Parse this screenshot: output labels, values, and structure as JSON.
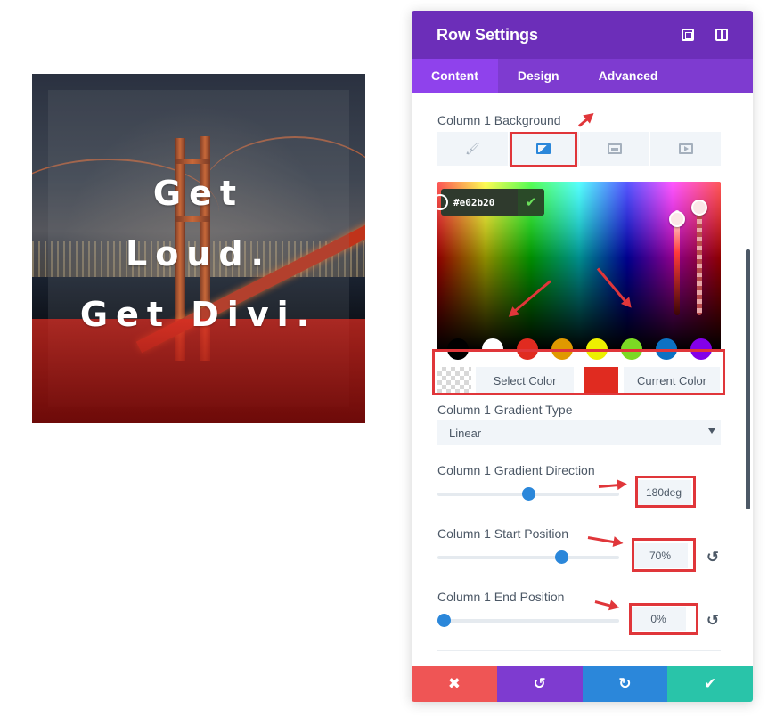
{
  "preview": {
    "headline_lines": [
      "Get",
      "Loud.",
      "Get Divi."
    ]
  },
  "panel": {
    "title": "Row Settings",
    "header_icons": [
      "expand-icon",
      "sidebar-toggle-icon"
    ],
    "tabs": [
      {
        "label": "Content",
        "active": true
      },
      {
        "label": "Design",
        "active": false
      },
      {
        "label": "Advanced",
        "active": false
      }
    ]
  },
  "background": {
    "label": "Column 1 Background",
    "type_tabs": [
      "color-bucket-icon",
      "gradient-icon",
      "image-icon",
      "video-icon"
    ],
    "active_type": "gradient-icon",
    "hex_value": "#e02b20",
    "swatches": [
      "#000000",
      "#ffffff",
      "#e02b20",
      "#e09900",
      "#edf000",
      "#7cda24",
      "#0c71c3",
      "#8300e9"
    ],
    "select_color_label": "Select Color",
    "current_color_label": "Current Color",
    "current_color": "#e02b20"
  },
  "gradient_type": {
    "label": "Column 1 Gradient Type",
    "value": "Linear"
  },
  "gradient_direction": {
    "label": "Column 1 Gradient Direction",
    "value": "180deg",
    "level": 180,
    "max": 360
  },
  "start_position": {
    "label": "Column 1 Start Position",
    "value": "70%",
    "level": 70,
    "max": 100
  },
  "end_position": {
    "label": "Column 1 End Position",
    "value": "0%",
    "level": 0,
    "max": 100
  },
  "footer": {
    "buttons": [
      "discard-icon",
      "undo-icon",
      "redo-icon",
      "save-checkmark-icon"
    ]
  },
  "colors": {
    "header_purple": "#6c2eb9",
    "tab_purple": "#7e3bd0",
    "accent_blue": "#2b87da",
    "annotation_red": "#e0363a"
  }
}
